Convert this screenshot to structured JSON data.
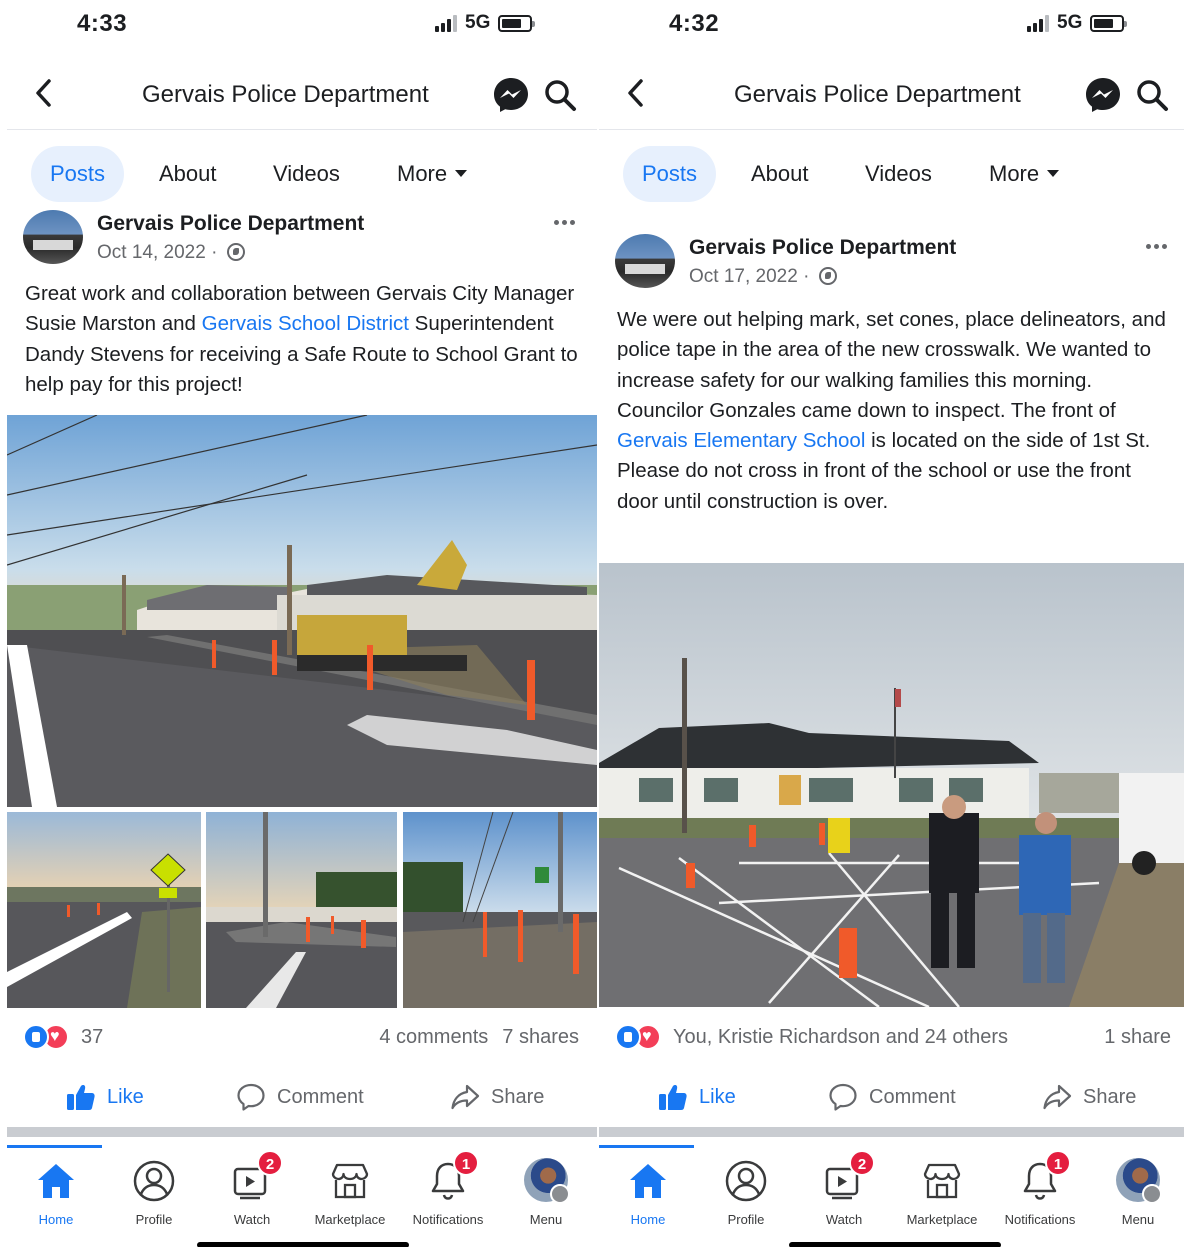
{
  "screens": [
    {
      "status": {
        "time": "4:33",
        "network": "5G"
      },
      "header": {
        "title": "Gervais Police Department"
      },
      "tabs": [
        {
          "label": "Posts",
          "active": true
        },
        {
          "label": "About"
        },
        {
          "label": "Videos"
        },
        {
          "label": "More"
        }
      ],
      "post": {
        "author": "Gervais Police Department",
        "date": "Oct 14, 2022 ·",
        "text_before": "Great work and collaboration between Gervais City Manager Susie Marston and ",
        "link": "Gervais School District",
        "text_after": " Superintendent Dandy Stevens for receiving a Safe Route to School Grant to help pay for this project!",
        "reaction_count": "37",
        "comments": "4 comments",
        "shares": "7 shares"
      },
      "actions": {
        "like": "Like",
        "comment": "Comment",
        "share": "Share"
      },
      "nav": [
        {
          "label": "Home",
          "active": true
        },
        {
          "label": "Profile"
        },
        {
          "label": "Watch",
          "badge": "2"
        },
        {
          "label": "Marketplace"
        },
        {
          "label": "Notifications",
          "badge": "1"
        },
        {
          "label": "Menu"
        }
      ]
    },
    {
      "status": {
        "time": "4:32",
        "network": "5G"
      },
      "header": {
        "title": "Gervais Police Department"
      },
      "tabs": [
        {
          "label": "Posts",
          "active": true
        },
        {
          "label": "About"
        },
        {
          "label": "Videos"
        },
        {
          "label": "More"
        }
      ],
      "post": {
        "author": "Gervais Police Department",
        "date": "Oct 17, 2022 ·",
        "text_before": "We were out helping mark, set cones, place delineators, and police tape in the area of the new crosswalk. We wanted to increase safety for our walking families this morning. Councilor Gonzales came down to inspect. The front of ",
        "link": "Gervais Elementary School",
        "text_after": " is located on the side of 1st St. Please do not cross in front of the school or use the front door until construction is over.",
        "reaction_count": "You, Kristie Richardson and 24 others",
        "comments": "",
        "shares": "1 share"
      },
      "actions": {
        "like": "Like",
        "comment": "Comment",
        "share": "Share"
      },
      "nav": [
        {
          "label": "Home",
          "active": true
        },
        {
          "label": "Profile"
        },
        {
          "label": "Watch",
          "badge": "2"
        },
        {
          "label": "Marketplace"
        },
        {
          "label": "Notifications",
          "badge": "1"
        },
        {
          "label": "Menu"
        }
      ]
    }
  ],
  "icons": [
    "back-icon",
    "messenger-icon",
    "search-icon",
    "globe-icon",
    "more-dots-icon",
    "like-icon",
    "comment-icon",
    "share-icon",
    "home-icon",
    "profile-icon",
    "watch-icon",
    "marketplace-icon",
    "notifications-icon"
  ],
  "colors": {
    "accent": "#1877f2",
    "badge": "#e41e3f",
    "love": "#f33e58",
    "text_secondary": "#65676b",
    "tab_active_bg": "#e7f0fd"
  }
}
